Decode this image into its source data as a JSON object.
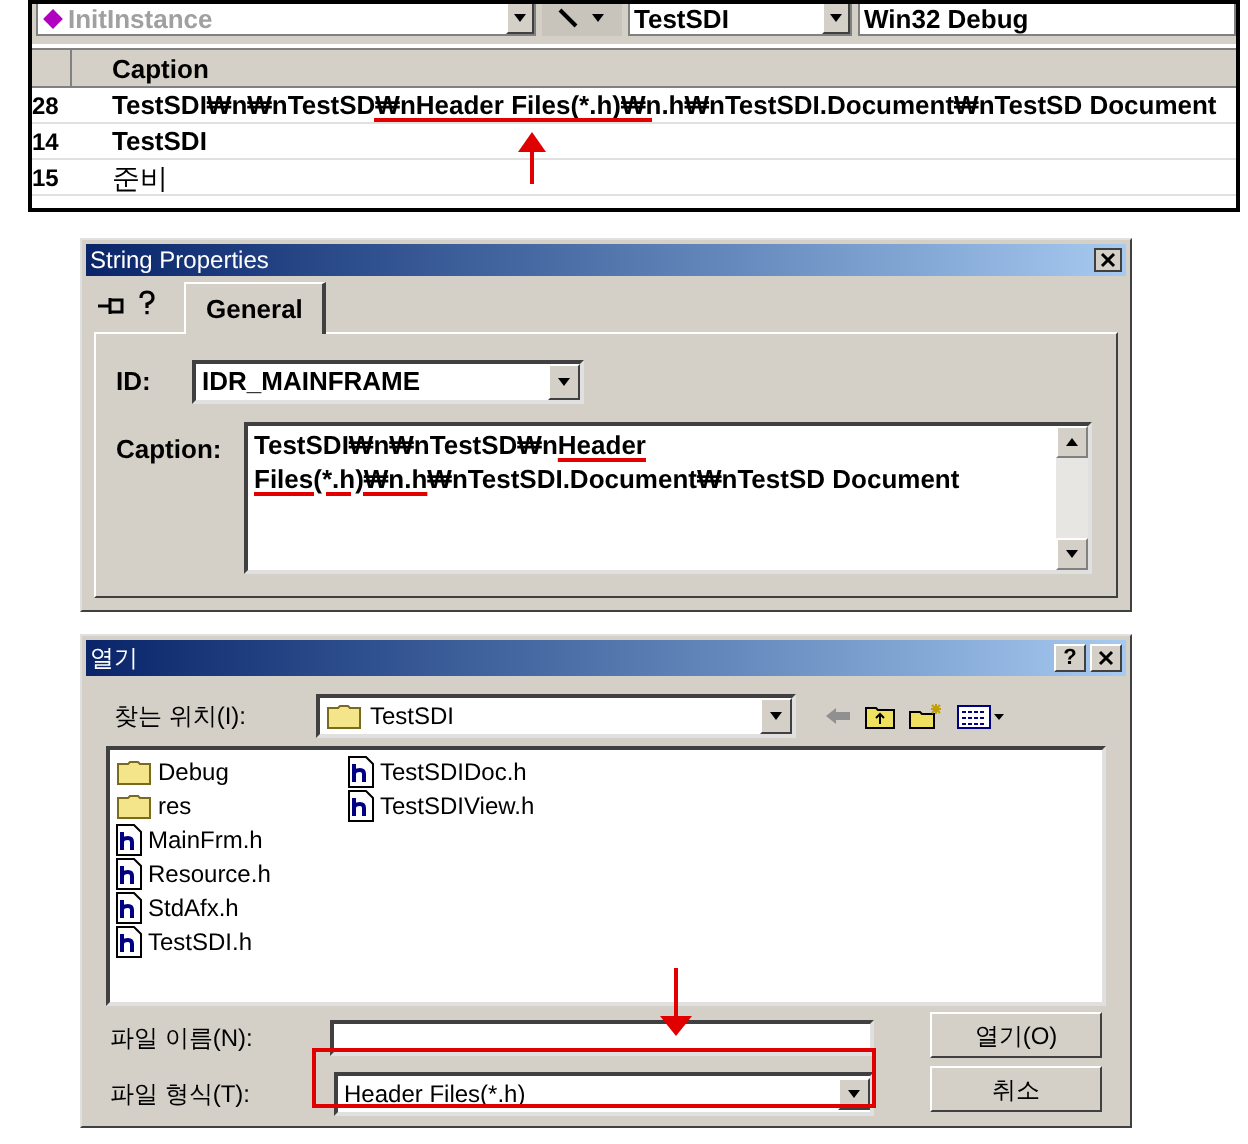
{
  "toolbar": {
    "function_combo": "InitInstance",
    "class_combo": "TestSDI",
    "config_combo": "Win32 Debug"
  },
  "string_table": {
    "columns": [
      "Caption"
    ],
    "rows": [
      {
        "id": "28",
        "caption": "TestSDI₩n₩nTestSD₩nHeader Files(*.h)₩n.h₩nTestSDI.Document₩nTestSD Document"
      },
      {
        "id": "14",
        "caption": "TestSDI"
      },
      {
        "id": "15",
        "caption": "준비"
      }
    ]
  },
  "string_properties": {
    "title": "String Properties",
    "tabs": [
      {
        "label": "General",
        "selected": true
      }
    ],
    "id_label": "ID:",
    "id_value": "IDR_MAINFRAME",
    "caption_label": "Caption:",
    "caption_lines": [
      [
        {
          "text": "TestSDI₩n₩nTestSD₩n",
          "underlined": false
        },
        {
          "text": "Header",
          "underlined": true
        }
      ],
      [
        {
          "text": "Files(*.h)₩n.h",
          "underlined": true
        },
        {
          "text": "₩nTestSDI.Document₩nTestSD Document",
          "underlined": false
        }
      ]
    ]
  },
  "open_dialog": {
    "title": "열기",
    "help_button": "?",
    "look_in_label": "찾는 위치(I):",
    "look_in_value": "TestSDI",
    "files": [
      {
        "name": "Debug",
        "kind": "folder"
      },
      {
        "name": "res",
        "kind": "folder"
      },
      {
        "name": "MainFrm.h",
        "kind": "header"
      },
      {
        "name": "Resource.h",
        "kind": "header"
      },
      {
        "name": "StdAfx.h",
        "kind": "header"
      },
      {
        "name": "TestSDI.h",
        "kind": "header"
      },
      {
        "name": "TestSDIDoc.h",
        "kind": "header"
      },
      {
        "name": "TestSDIView.h",
        "kind": "header"
      }
    ],
    "filename_label": "파일 이름(N):",
    "filetype_label": "파일 형식(T):",
    "filetype_value": "Header Files(*.h)",
    "buttons": [
      "열기(O)",
      "취소"
    ]
  }
}
